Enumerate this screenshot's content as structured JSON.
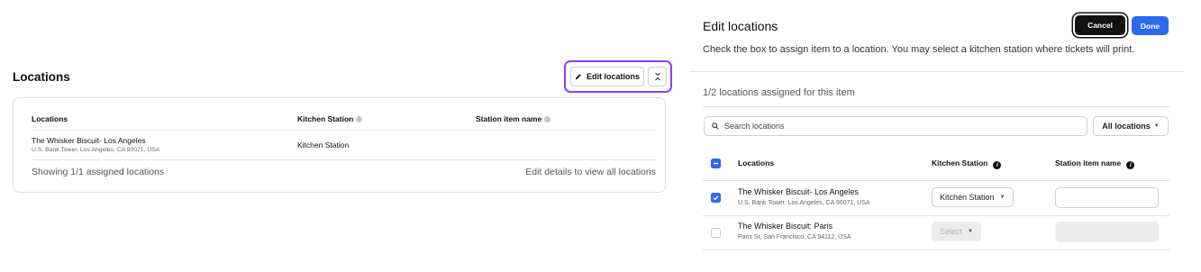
{
  "left": {
    "title": "Locations",
    "edit_button_label": "Edit locations",
    "table": {
      "columns": [
        "Locations",
        "Kitchen Station",
        "Station item name"
      ],
      "rows": [
        {
          "name": "The Whisker Biscuit- Los Angeles",
          "address": "U.S. Bank Tower, Los Angeles, CA 90071, USA",
          "kitchen_station": "Kitchen Station",
          "station_item_name": ""
        }
      ],
      "footer_left": "Showing 1/1 assigned locations",
      "footer_right": "Edit details to view all locations"
    }
  },
  "right": {
    "title": "Edit locations",
    "subtitle": "Check the box to assign item to a location. You may select a kitchen station where tickets will print.",
    "cancel_label": "Cancel",
    "done_label": "Done",
    "assigned_text": "1/2 locations assigned for this item",
    "search_placeholder": "Search locations",
    "filter_label": "All locations",
    "columns": [
      "Locations",
      "Kitchen Station",
      "Station item name"
    ],
    "rows": [
      {
        "checked": true,
        "name": "The Whisker Biscuit- Los Angeles",
        "address": "U.S. Bank Tower, Los Angeles, CA 90071, USA",
        "kitchen_station": "Kitchen Station",
        "station_item_name": ""
      },
      {
        "checked": false,
        "name": "The Whisker Biscuit: Paris",
        "address": "Paris St, San Francisco, CA 94112, USA",
        "kitchen_station": "Select",
        "station_item_name": ""
      }
    ]
  },
  "colors": {
    "accent_blue": "#2d68f0",
    "focus_purple": "#8a3ffc",
    "cancel_black": "#111111"
  }
}
